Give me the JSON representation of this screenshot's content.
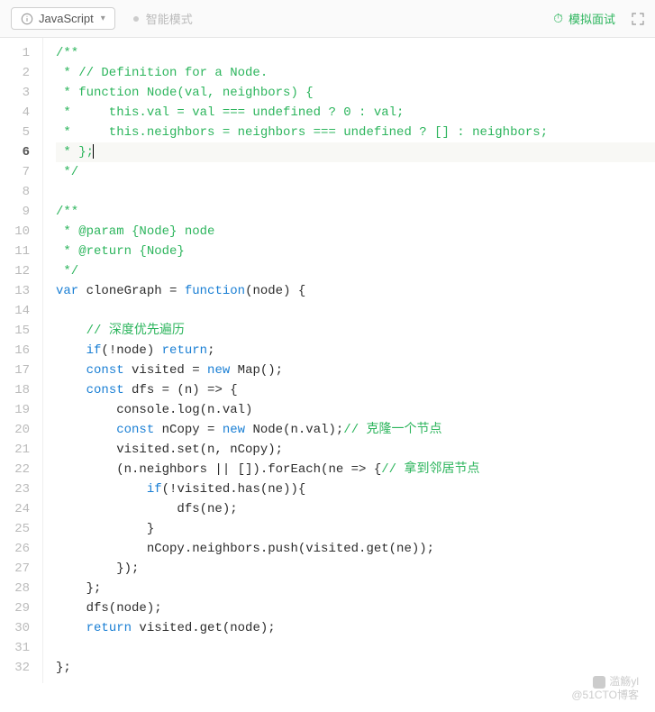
{
  "toolbar": {
    "language": "JavaScript",
    "mode_label": "智能模式",
    "mock_interview": "模拟面试"
  },
  "watermark": {
    "line1": "滥觞yl",
    "line2": "@51CTO博客"
  },
  "code": {
    "lines": [
      {
        "n": 1,
        "t": "comment",
        "text": "/**"
      },
      {
        "n": 2,
        "t": "comment",
        "text": " * // Definition for a Node."
      },
      {
        "n": 3,
        "t": "comment",
        "text": " * function Node(val, neighbors) {"
      },
      {
        "n": 4,
        "t": "comment",
        "text": " *     this.val = val === undefined ? 0 : val;"
      },
      {
        "n": 5,
        "t": "comment",
        "text": " *     this.neighbors = neighbors === undefined ? [] : neighbors;"
      },
      {
        "n": 6,
        "t": "comment",
        "text": " * };",
        "current": true,
        "cursor": true
      },
      {
        "n": 7,
        "t": "comment",
        "text": " */"
      },
      {
        "n": 8,
        "t": "plain",
        "text": ""
      },
      {
        "n": 9,
        "t": "comment",
        "text": "/**"
      },
      {
        "n": 10,
        "t": "comment",
        "text": " * @param {Node} node"
      },
      {
        "n": 11,
        "t": "comment",
        "text": " * @return {Node}"
      },
      {
        "n": 12,
        "t": "comment",
        "text": " */"
      },
      {
        "n": 13,
        "t": "mixed",
        "segments": [
          {
            "c": "keyword",
            "s": "var"
          },
          {
            "c": "plain",
            "s": " cloneGraph = "
          },
          {
            "c": "keyword",
            "s": "function"
          },
          {
            "c": "plain",
            "s": "(node) {"
          }
        ]
      },
      {
        "n": 14,
        "t": "plain",
        "text": ""
      },
      {
        "n": 15,
        "t": "mixed",
        "segments": [
          {
            "c": "plain",
            "s": "    "
          },
          {
            "c": "comment",
            "s": "// 深度优先遍历"
          }
        ]
      },
      {
        "n": 16,
        "t": "mixed",
        "segments": [
          {
            "c": "plain",
            "s": "    "
          },
          {
            "c": "keyword",
            "s": "if"
          },
          {
            "c": "plain",
            "s": "(!node) "
          },
          {
            "c": "keyword",
            "s": "return"
          },
          {
            "c": "plain",
            "s": ";"
          }
        ]
      },
      {
        "n": 17,
        "t": "mixed",
        "segments": [
          {
            "c": "plain",
            "s": "    "
          },
          {
            "c": "keyword",
            "s": "const"
          },
          {
            "c": "plain",
            "s": " visited = "
          },
          {
            "c": "keyword",
            "s": "new"
          },
          {
            "c": "plain",
            "s": " Map();"
          }
        ]
      },
      {
        "n": 18,
        "t": "mixed",
        "segments": [
          {
            "c": "plain",
            "s": "    "
          },
          {
            "c": "keyword",
            "s": "const"
          },
          {
            "c": "plain",
            "s": " dfs = (n) => {"
          }
        ]
      },
      {
        "n": 19,
        "t": "plain",
        "text": "        console.log(n.val)"
      },
      {
        "n": 20,
        "t": "mixed",
        "segments": [
          {
            "c": "plain",
            "s": "        "
          },
          {
            "c": "keyword",
            "s": "const"
          },
          {
            "c": "plain",
            "s": " nCopy = "
          },
          {
            "c": "keyword",
            "s": "new"
          },
          {
            "c": "plain",
            "s": " Node(n.val);"
          },
          {
            "c": "comment",
            "s": "// 克隆一个节点"
          }
        ]
      },
      {
        "n": 21,
        "t": "plain",
        "text": "        visited.set(n, nCopy);"
      },
      {
        "n": 22,
        "t": "mixed",
        "segments": [
          {
            "c": "plain",
            "s": "        (n.neighbors || []).forEach(ne => {"
          },
          {
            "c": "comment",
            "s": "// 拿到邻居节点"
          }
        ]
      },
      {
        "n": 23,
        "t": "mixed",
        "segments": [
          {
            "c": "plain",
            "s": "            "
          },
          {
            "c": "keyword",
            "s": "if"
          },
          {
            "c": "plain",
            "s": "(!visited.has(ne)){"
          }
        ]
      },
      {
        "n": 24,
        "t": "plain",
        "text": "                dfs(ne);"
      },
      {
        "n": 25,
        "t": "plain",
        "text": "            }"
      },
      {
        "n": 26,
        "t": "plain",
        "text": "            nCopy.neighbors.push(visited.get(ne));"
      },
      {
        "n": 27,
        "t": "plain",
        "text": "        });"
      },
      {
        "n": 28,
        "t": "plain",
        "text": "    };"
      },
      {
        "n": 29,
        "t": "plain",
        "text": "    dfs(node);"
      },
      {
        "n": 30,
        "t": "mixed",
        "segments": [
          {
            "c": "plain",
            "s": "    "
          },
          {
            "c": "keyword",
            "s": "return"
          },
          {
            "c": "plain",
            "s": " visited.get(node);"
          }
        ]
      },
      {
        "n": 31,
        "t": "plain",
        "text": ""
      },
      {
        "n": 32,
        "t": "plain",
        "text": "};"
      }
    ]
  }
}
